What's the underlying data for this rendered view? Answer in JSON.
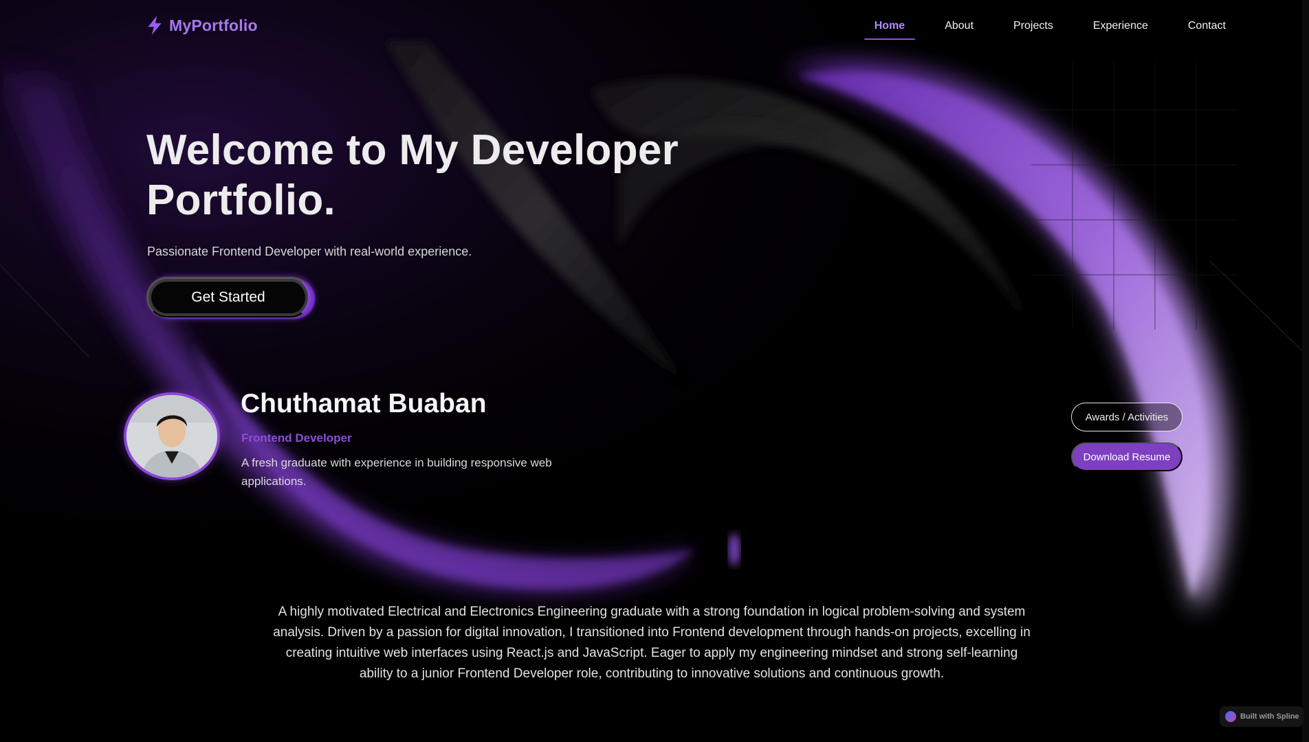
{
  "nav": {
    "logo_text": "MyPortfolio",
    "links": [
      {
        "label": "Home",
        "active": true
      },
      {
        "label": "About",
        "active": false
      },
      {
        "label": "Projects",
        "active": false
      },
      {
        "label": "Experience",
        "active": false
      },
      {
        "label": "Contact",
        "active": false
      }
    ]
  },
  "hero": {
    "title": "Welcome to My Developer Portfolio.",
    "subtitle": "Passionate Frontend Developer with real-world experience.",
    "cta_label": "Get Started"
  },
  "profile": {
    "name": "Chuthamat Buaban",
    "role": "Frontend Developer",
    "description": "A fresh graduate with experience in building responsive web applications.",
    "awards_button": "Awards / Activities",
    "resume_button": "Download Resume"
  },
  "about": {
    "paragraph": "A highly motivated Electrical and Electronics Engineering graduate with a strong foundation in logical problem-solving and system analysis. Driven by a passion for digital innovation, I transitioned into Frontend development through hands-on projects, excelling in creating intuitive web interfaces using React.js and JavaScript. Eager to apply my engineering mindset and strong self-learning ability to a junior Frontend Developer role, contributing to innovative solutions and continuous growth."
  },
  "badge": {
    "label": "Built with Spline"
  },
  "colors": {
    "accent": "#8d4fe0",
    "logo": "#a978f0",
    "role": "#8a4fd6",
    "resume_button": "#7e3fc0",
    "background": "#000000"
  }
}
